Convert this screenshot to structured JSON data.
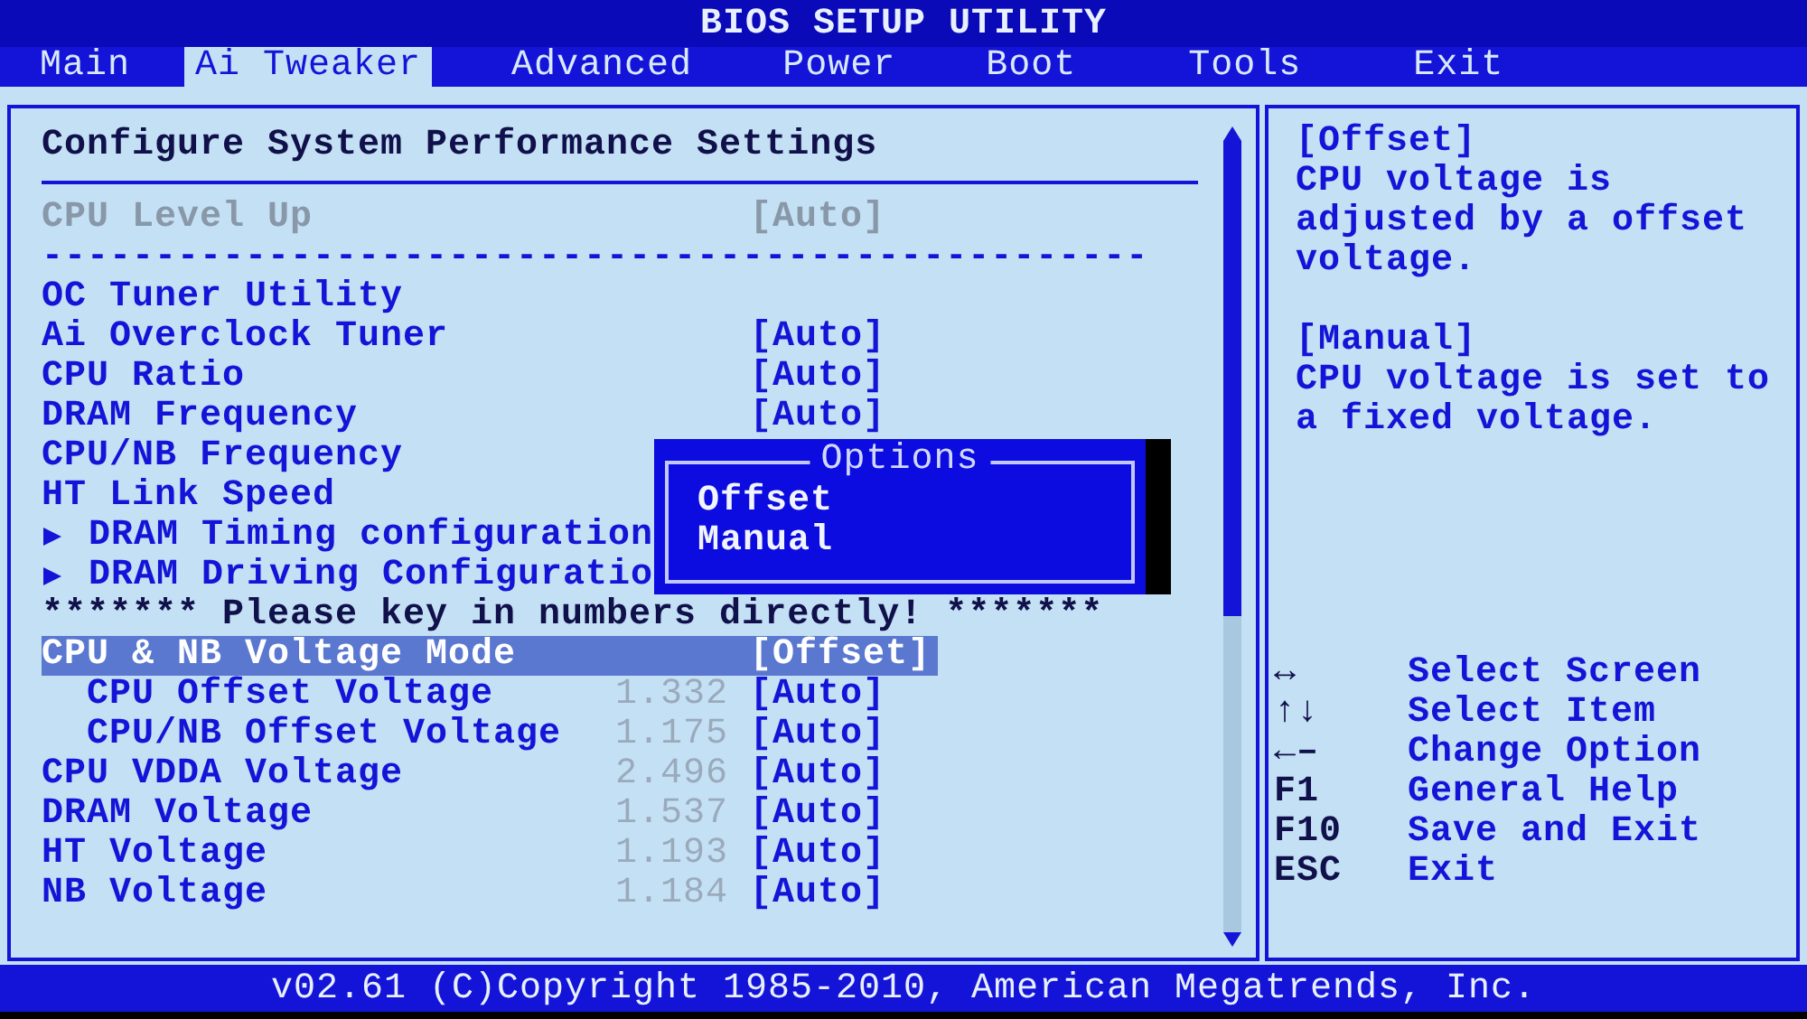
{
  "window": {
    "title": "BIOS SETUP UTILITY"
  },
  "tabs": [
    {
      "label": "Main",
      "selected": false
    },
    {
      "label": "Ai Tweaker",
      "selected": true
    },
    {
      "label": "Advanced",
      "selected": false
    },
    {
      "label": "Power",
      "selected": false
    },
    {
      "label": "Boot",
      "selected": false
    },
    {
      "label": "Tools",
      "selected": false
    },
    {
      "label": "Exit",
      "selected": false
    }
  ],
  "panel": {
    "title": "Configure System Performance Settings",
    "rows": [
      {
        "kind": "setting",
        "label": "CPU Level Up",
        "value": "[Auto]",
        "disabled": true,
        "selected": false
      },
      {
        "kind": "separator",
        "text": "-------------------------------------------------"
      },
      {
        "kind": "setting",
        "label": "OC Tuner Utility",
        "disabled": false,
        "selected": false
      },
      {
        "kind": "setting",
        "label": "Ai Overclock Tuner",
        "value": "[Auto]",
        "disabled": false,
        "selected": false
      },
      {
        "kind": "setting",
        "label": "CPU Ratio",
        "value": "[Auto]",
        "disabled": false,
        "selected": false
      },
      {
        "kind": "setting",
        "label": "DRAM Frequency",
        "value": "[Auto]",
        "disabled": false,
        "selected": false
      },
      {
        "kind": "setting",
        "label": "CPU/NB Frequency",
        "disabled": false,
        "selected": false
      },
      {
        "kind": "setting",
        "label": "HT Link Speed",
        "disabled": false,
        "selected": false
      },
      {
        "kind": "submenu",
        "label": "DRAM Timing configuration",
        "selected": false
      },
      {
        "kind": "submenu",
        "label": "DRAM Driving Configuratio",
        "selected": false
      },
      {
        "kind": "note",
        "text": "******* Please key in numbers directly! *******"
      },
      {
        "kind": "setting",
        "label": "CPU & NB Voltage Mode",
        "value": "[Offset]",
        "disabled": false,
        "selected": true,
        "children": [
          {
            "kind": "setting",
            "label": "CPU Offset Voltage",
            "reading": "1.332",
            "value": "[Auto]",
            "disabled": false,
            "selected": false
          },
          {
            "kind": "setting",
            "label": "CPU/NB Offset Voltage",
            "reading": "1.175",
            "value": "[Auto]",
            "disabled": false,
            "selected": false
          }
        ]
      },
      {
        "kind": "setting",
        "label": "CPU VDDA Voltage",
        "reading": "2.496",
        "value": "[Auto]",
        "disabled": false,
        "selected": false
      },
      {
        "kind": "setting",
        "label": "DRAM Voltage",
        "reading": "1.537",
        "value": "[Auto]",
        "disabled": false,
        "selected": false
      },
      {
        "kind": "setting",
        "label": "HT Voltage",
        "reading": "1.193",
        "value": "[Auto]",
        "disabled": false,
        "selected": false
      },
      {
        "kind": "setting",
        "label": "NB Voltage",
        "reading": "1.184",
        "value": "[Auto]",
        "disabled": false,
        "selected": false
      }
    ]
  },
  "popup": {
    "title": "Options",
    "options": [
      {
        "label": "Offset",
        "selected": false
      },
      {
        "label": "Manual",
        "selected": false
      }
    ]
  },
  "help": [
    {
      "heading": "[Offset]",
      "text": "CPU voltage is adjusted by a offset voltage."
    },
    {
      "heading": "[Manual]",
      "text": "CPU voltage is set to a fixed voltage."
    }
  ],
  "keys": [
    {
      "key": "↔",
      "action": "Select Screen"
    },
    {
      "key": "↑↓",
      "action": "Select Item"
    },
    {
      "key": "←–",
      "action": "Change Option"
    },
    {
      "key": "F1",
      "action": "General Help"
    },
    {
      "key": "F10",
      "action": "Save and Exit"
    },
    {
      "key": "ESC",
      "action": "Exit"
    }
  ],
  "status_bar": "v02.61 (C)Copyright 1985-2010, American Megatrends, Inc."
}
